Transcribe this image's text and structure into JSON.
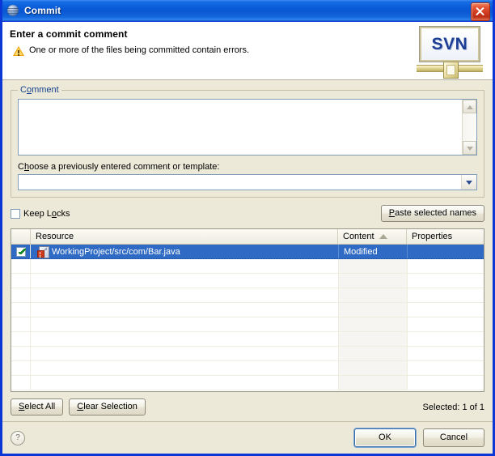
{
  "window": {
    "title": "Commit",
    "icon": "globe-icon",
    "close_label": "Close"
  },
  "header": {
    "title": "Enter a commit comment",
    "message": "One or more of the files being committed contain errors.",
    "warning_icon": "warning-triangle-icon",
    "logo_text": "SVN"
  },
  "comment_group": {
    "legend": "Comment",
    "legend_mnemonic_before": "C",
    "legend_mnemonic": "o",
    "legend_mnemonic_after": "mment",
    "textarea_value": "",
    "textarea_placeholder": "",
    "choose_label": "Choose a previously entered comment or template:",
    "choose_mnemonic_before": "C",
    "choose_mnemonic": "h",
    "choose_mnemonic_after": "oose a previously entered comment or template:",
    "combo_value": "",
    "combo_options": []
  },
  "locks_row": {
    "keep_locks_label_before": "Keep L",
    "keep_locks_mnemonic": "o",
    "keep_locks_label_after": "cks",
    "keep_locks_checked": false,
    "paste_button_mnemonic": "P",
    "paste_button_label_after": "aste selected names"
  },
  "table": {
    "columns": [
      {
        "key": "check",
        "label": ""
      },
      {
        "key": "resource",
        "label": "Resource",
        "sorted": false
      },
      {
        "key": "content",
        "label": "Content",
        "sorted": true,
        "sort_dir": "asc"
      },
      {
        "key": "properties",
        "label": "Properties",
        "sorted": false
      }
    ],
    "rows": [
      {
        "checked": true,
        "icon": "java-file-error-icon",
        "resource": "WorkingProject/src/com/Bar.java",
        "content": "Modified",
        "properties": "",
        "selected": true
      }
    ],
    "empty_row_count": 9
  },
  "selection_row": {
    "select_all_mnemonic": "S",
    "select_all_label_after": "elect All",
    "clear_selection_mnemonic": "C",
    "clear_selection_label_after": "lear Selection",
    "selected_status": "Selected: 1 of 1"
  },
  "footer": {
    "help_glyph": "?",
    "ok_label": "OK",
    "cancel_label": "Cancel"
  },
  "colors": {
    "titlebar_blue": "#0a57d2",
    "window_border": "#0a37d6",
    "panel_bg": "#ece9d8",
    "selection_blue": "#2f6ac4",
    "link_blue": "#16418c",
    "close_red": "#d03b1e",
    "warning_orange": "#f0a30a",
    "svn_blue": "#1c3f94"
  }
}
